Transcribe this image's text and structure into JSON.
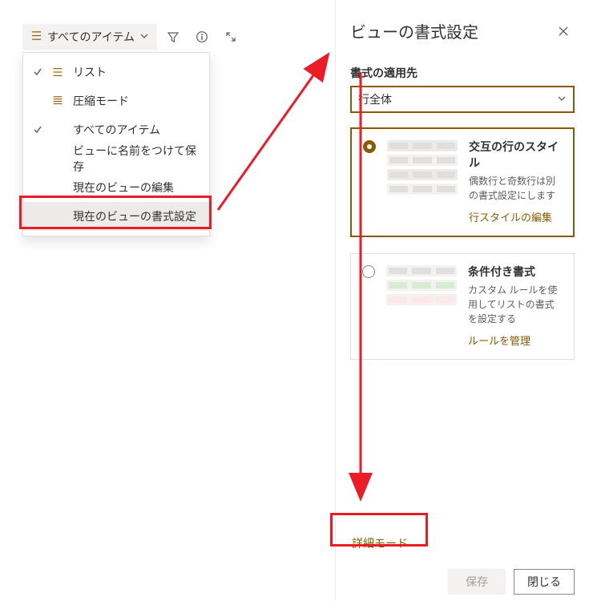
{
  "toolbar": {
    "view_switcher_label": "すべてのアイテム"
  },
  "dropdown": {
    "items": [
      {
        "label": "リスト",
        "checked": true,
        "icon": "list"
      },
      {
        "label": "圧縮モード",
        "checked": false,
        "icon": "compact"
      },
      {
        "label": "すべてのアイテム",
        "checked": true,
        "icon": ""
      },
      {
        "label": "ビューに名前をつけて保存",
        "checked": false,
        "icon": ""
      },
      {
        "label": "現在のビューの編集",
        "checked": false,
        "icon": ""
      },
      {
        "label": "現在のビューの書式設定",
        "checked": false,
        "icon": ""
      }
    ]
  },
  "panel": {
    "title": "ビューの書式設定",
    "apply_to_label": "書式の適用先",
    "apply_to_value": "行全体",
    "cards": [
      {
        "title": "交互の行のスタイル",
        "desc": "偶数行と奇数行は別の書式設定にします",
        "link": "行スタイルの編集",
        "selected": true
      },
      {
        "title": "条件付き書式",
        "desc": "カスタム ルールを使用してリストの書式を設定する",
        "link": "ルールを管理",
        "selected": false
      }
    ],
    "advanced_link": "詳細モード",
    "save_label": "保存",
    "close_label": "閉じる"
  }
}
